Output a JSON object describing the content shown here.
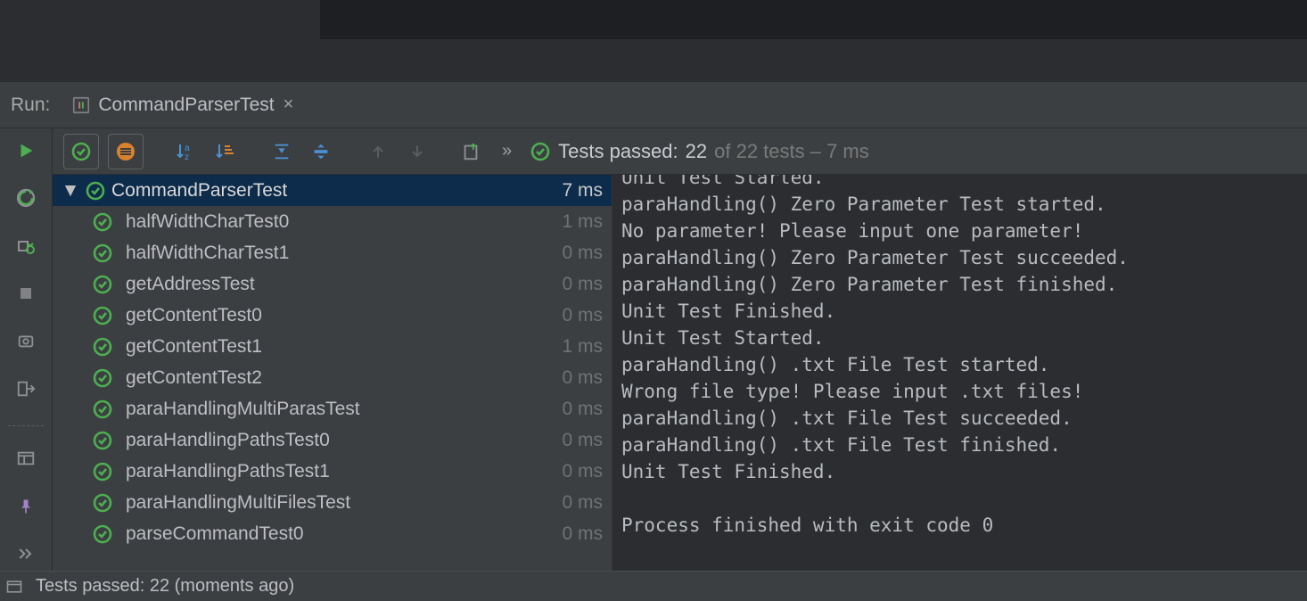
{
  "tabstrip": {
    "run_label": "Run:",
    "tab_title": "CommandParserTest"
  },
  "summary": {
    "prefix": "Tests passed:",
    "passed_count": "22",
    "of_text": "of 22 tests – 7 ms"
  },
  "tree": {
    "root_name": "CommandParserTest",
    "root_time": "7 ms",
    "children": [
      {
        "name": "halfWidthCharTest0",
        "time": "1 ms"
      },
      {
        "name": "halfWidthCharTest1",
        "time": "0 ms"
      },
      {
        "name": "getAddressTest",
        "time": "0 ms"
      },
      {
        "name": "getContentTest0",
        "time": "0 ms"
      },
      {
        "name": "getContentTest1",
        "time": "1 ms"
      },
      {
        "name": "getContentTest2",
        "time": "0 ms"
      },
      {
        "name": "paraHandlingMultiParasTest",
        "time": "0 ms"
      },
      {
        "name": "paraHandlingPathsTest0",
        "time": "0 ms"
      },
      {
        "name": "paraHandlingPathsTest1",
        "time": "0 ms"
      },
      {
        "name": "paraHandlingMultiFilesTest",
        "time": "0 ms"
      },
      {
        "name": "parseCommandTest0",
        "time": "0 ms"
      }
    ]
  },
  "console_lines": [
    "Unit Test Started.",
    "paraHandling() Zero Parameter Test started.",
    "No parameter! Please input one parameter!",
    "paraHandling() Zero Parameter Test succeeded.",
    "paraHandling() Zero Parameter Test finished.",
    "Unit Test Finished.",
    "Unit Test Started.",
    "paraHandling() .txt File Test started.",
    "Wrong file type! Please input .txt files!",
    "paraHandling() .txt File Test succeeded.",
    "paraHandling() .txt File Test finished.",
    "Unit Test Finished.",
    "",
    "Process finished with exit code 0",
    ""
  ],
  "status": {
    "text": "Tests passed: 22 (moments ago)"
  }
}
